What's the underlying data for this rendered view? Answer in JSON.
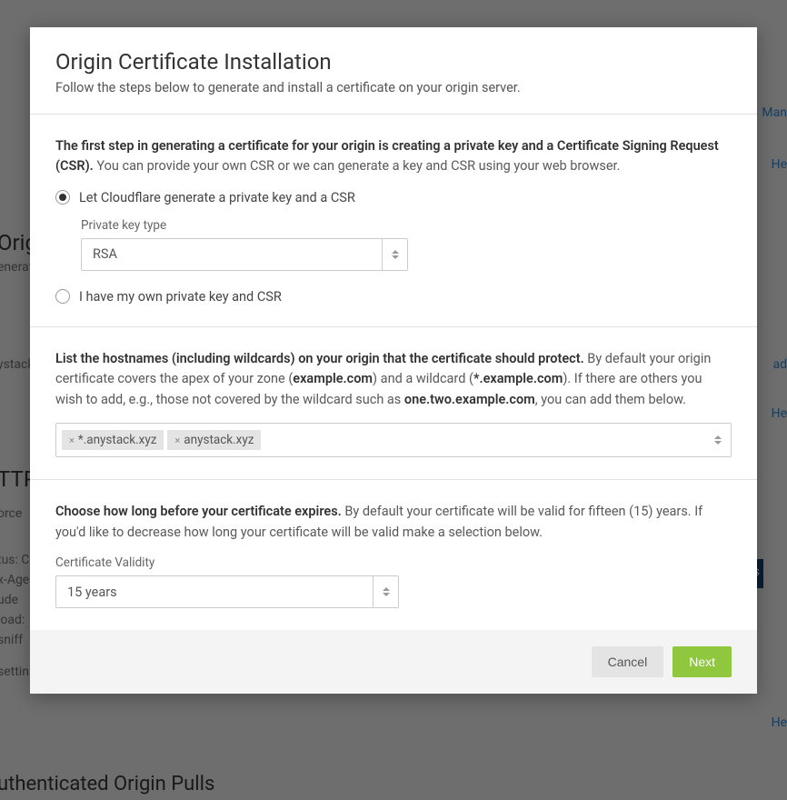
{
  "bg": {
    "link_man": "Man",
    "link_he1": "He",
    "link_he2": "He",
    "link_he3": "He",
    "orig_heading": "Origin",
    "orig_sub": "enerat",
    "ystac": "ystack",
    "oad": "ad",
    "ttp_heading": "TTP",
    "orce": "orce",
    "tus": "tus: C",
    "xage": "x-Age",
    "ude": "ude",
    "oad2": "load:",
    "sniff": "sniff",
    "settin": "settin",
    "pulls": "uthenticated Origin Pulls",
    "s_blue": "s"
  },
  "modal": {
    "title": "Origin Certificate Installation",
    "subtitle": "Follow the steps below to generate and install a certificate on your origin server.",
    "step1_bold": "The first step in generating a certificate for your origin is creating a private key and a Certificate Signing Request (CSR).",
    "step1_rest": " You can provide your own CSR or we can generate a key and CSR using your web browser.",
    "radio1": "Let Cloudflare generate a private key and a CSR",
    "pk_label": "Private key type",
    "pk_value": "RSA",
    "radio2": "I have my own private key and CSR",
    "step2_bold": "List the hostnames (including wildcards) on your origin that the certificate should protect.",
    "step2_p1": " By default your origin certificate covers the apex of your zone (",
    "step2_b1": "example.com",
    "step2_p2": ") and a wildcard (",
    "step2_b2": "*.example.com",
    "step2_p3": "). If there are others you wish to add, e.g., those not covered by the wildcard such as ",
    "step2_b3": "one.two.example.com",
    "step2_p4": ", you can add them below.",
    "tags": [
      "*.anystack.xyz",
      "anystack.xyz"
    ],
    "step3_bold": "Choose how long before your certificate expires.",
    "step3_rest": " By default your certificate will be valid for fifteen (15) years. If you'd like to decrease how long your certificate will be valid make a selection below.",
    "validity_label": "Certificate Validity",
    "validity_value": "15 years",
    "btn_cancel": "Cancel",
    "btn_next": "Next"
  }
}
